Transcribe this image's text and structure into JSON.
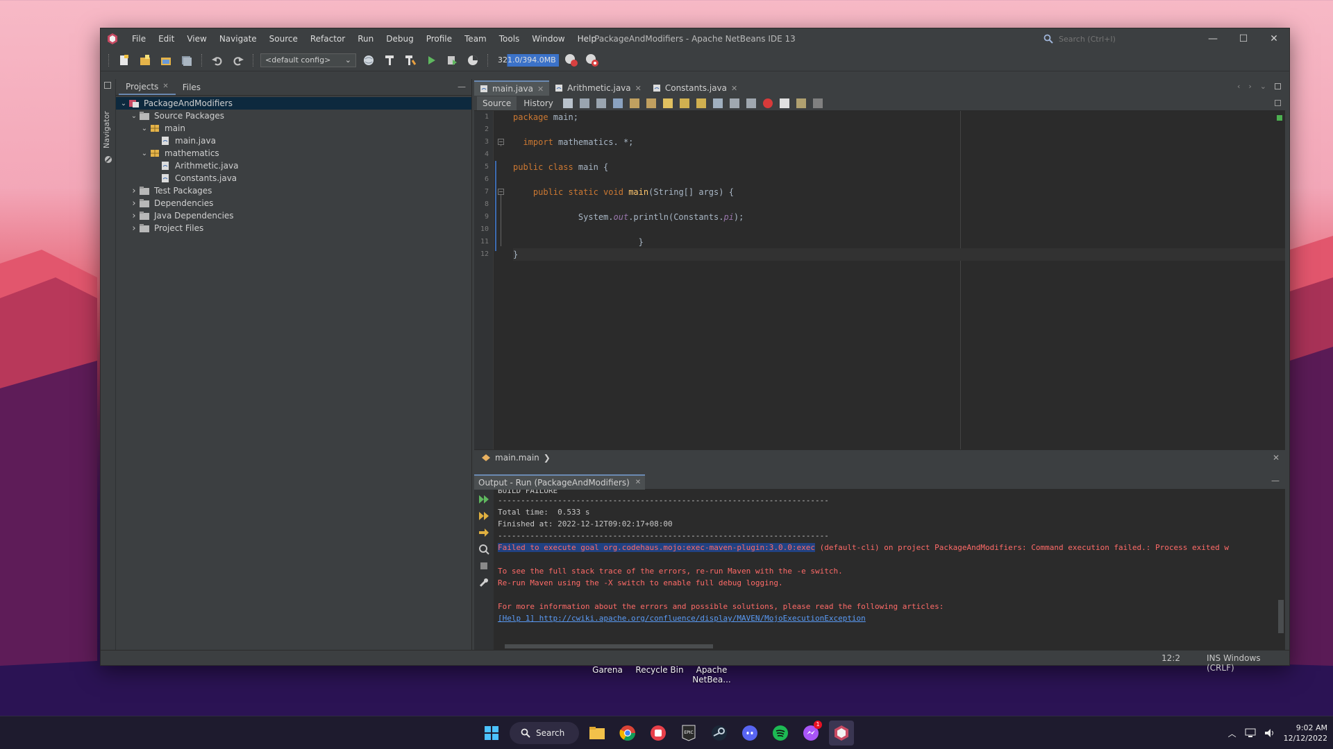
{
  "window": {
    "title": "PackageAndModifiers - Apache NetBeans IDE 13",
    "menu": [
      "File",
      "Edit",
      "View",
      "Navigate",
      "Source",
      "Refactor",
      "Run",
      "Debug",
      "Profile",
      "Team",
      "Tools",
      "Window",
      "Help"
    ],
    "search_placeholder": "Search (Ctrl+I)",
    "controls": {
      "minimize": "—",
      "maximize": "☐",
      "close": "✕"
    }
  },
  "toolbar": {
    "config": "<default config>",
    "memory": "321.0/394.0MB",
    "memory_fraction": 0.81
  },
  "side": {
    "navigator": "Navigator"
  },
  "projects": {
    "tabs": [
      "Projects",
      "Files"
    ],
    "tree": [
      {
        "label": "PackageAndModifiers",
        "level": 0,
        "expanded": true,
        "icon": "project-icon",
        "selected": true
      },
      {
        "label": "Source Packages",
        "level": 1,
        "expanded": true,
        "icon": "folder-icon"
      },
      {
        "label": "main",
        "level": 2,
        "expanded": true,
        "icon": "package-icon"
      },
      {
        "label": "main.java",
        "level": 3,
        "icon": "java-file-icon"
      },
      {
        "label": "mathematics",
        "level": 2,
        "expanded": true,
        "icon": "package-icon"
      },
      {
        "label": "Arithmetic.java",
        "level": 3,
        "icon": "java-file-icon"
      },
      {
        "label": "Constants.java",
        "level": 3,
        "icon": "java-file-icon"
      },
      {
        "label": "Test Packages",
        "level": 1,
        "expanded": false,
        "icon": "folder-icon"
      },
      {
        "label": "Dependencies",
        "level": 1,
        "expanded": false,
        "icon": "folder-icon"
      },
      {
        "label": "Java Dependencies",
        "level": 1,
        "expanded": false,
        "icon": "folder-icon"
      },
      {
        "label": "Project Files",
        "level": 1,
        "expanded": false,
        "icon": "folder-icon"
      }
    ]
  },
  "editor": {
    "tabs": [
      {
        "label": "main.java",
        "active": true
      },
      {
        "label": "Arithmetic.java",
        "active": false
      },
      {
        "label": "Constants.java",
        "active": false
      }
    ],
    "source_label": "Source",
    "history_label": "History",
    "line_numbers": [
      "1",
      "2",
      "3",
      "4",
      "5",
      "6",
      "7",
      "8",
      "9",
      "10",
      "11",
      "12"
    ],
    "lines": {
      "l1_kw": "package",
      "l1_rest": " main;",
      "l3_kw": "import",
      "l3_rest": " mathematics. *;",
      "l5_kw": "public class",
      "l5_rest": " main {",
      "l7_kw": "public static void",
      "l7_fn": "main",
      "l7_rest": "(String[] args) {",
      "l9_a": "System.",
      "l9_out": "out",
      "l9_b": ".println(Constants.",
      "l9_pi": "pi",
      "l9_c": ");",
      "l11": "}",
      "l12": "}"
    },
    "breadcrumb": "main.main"
  },
  "output": {
    "tab_label": "Output - Run (PackageAndModifiers)",
    "lines": {
      "build_failure": "BUILD FAILURE",
      "sep1": "------------------------------------------------------------------------",
      "total_time": "Total time:  0.533 s",
      "finished": "Finished at: 2022-12-12T09:02:17+08:00",
      "sep2": "------------------------------------------------------------------------",
      "err_hl": "Failed to execute goal org.codehaus.mojo:exec-maven-plugin:3.0.0:exec",
      "err_rest": " (default-cli) on project PackageAndModifiers: Command execution failed.: Process exited w",
      "stack1": "To see the full stack trace of the errors, re-run Maven with the -e switch.",
      "stack2": "Re-run Maven using the -X switch to enable full debug logging.",
      "more_info": "For more information about the errors and possible solutions, please read the following articles:",
      "help_link": "[Help 1] http://cwiki.apache.org/confluence/display/MAVEN/MojoExecutionException"
    }
  },
  "statusbar": {
    "position": "12:2",
    "mode": "INS Windows (CRLF)"
  },
  "desktop": {
    "icons": [
      "Garena",
      "Recycle Bin",
      "Apache NetBea..."
    ]
  },
  "taskbar": {
    "search_label": "Search",
    "messenger_badge": "1",
    "time": "9:02 AM",
    "date": "12/12/2022"
  }
}
